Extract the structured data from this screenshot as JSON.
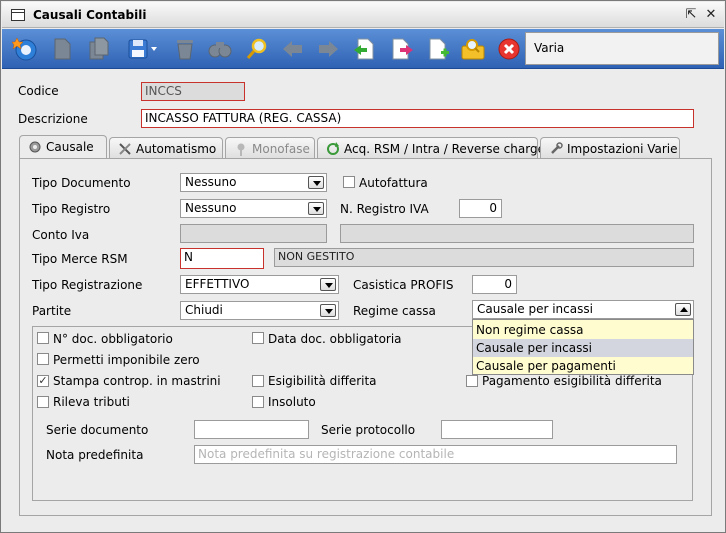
{
  "window": {
    "title": "Causali Contabili",
    "controls": [
      "restore",
      "close"
    ]
  },
  "toolbar": {
    "icons": [
      "home-icon",
      "document-icon",
      "copy-icon",
      "save-icon",
      "trash-icon",
      "binoculars-icon",
      "magnifier-icon",
      "back-arrow-icon",
      "forward-arrow-icon",
      "import-icon",
      "export-icon",
      "new-document-icon",
      "search-folder-icon",
      "cancel-icon"
    ],
    "varia_label": "Varia"
  },
  "header": {
    "codice_label": "Codice",
    "codice_value": "INCCS",
    "descrizione_label": "Descrizione",
    "descrizione_value": "INCASSO FATTURA (REG. CASSA)"
  },
  "tabs": [
    {
      "label": "Causale",
      "icon": "gear-icon"
    },
    {
      "label": "Automatismo",
      "icon": "tools-icon"
    },
    {
      "label": "Monofase",
      "icon": "pin-icon"
    },
    {
      "label": "Acq. RSM / Intra / Reverse charge",
      "icon": "refresh-icon"
    },
    {
      "label": "Impostazioni Varie",
      "icon": "wrench-icon"
    }
  ],
  "form": {
    "tipo_documento": {
      "label": "Tipo Documento",
      "value": "Nessuno"
    },
    "autofattura": {
      "label": "Autofattura"
    },
    "tipo_registro": {
      "label": "Tipo Registro",
      "value": "Nessuno"
    },
    "n_registro_iva": {
      "label": "N. Registro IVA",
      "value": "0"
    },
    "conto_iva": {
      "label": "Conto Iva"
    },
    "tipo_merce_rsm": {
      "label": "Tipo Merce RSM",
      "value": "N",
      "description": "NON GESTITO"
    },
    "tipo_registrazione": {
      "label": "Tipo Registrazione",
      "value": "EFFETTIVO"
    },
    "casistica_profis": {
      "label": "Casistica PROFIS",
      "value": "0"
    },
    "partite": {
      "label": "Partite",
      "value": "Chiudi"
    },
    "regime_cassa": {
      "label": "Regime cassa",
      "value": "Causale per incassi"
    }
  },
  "regime_dropdown": {
    "options": [
      "Non regime cassa",
      "Causale per incassi",
      "Causale per pagamenti"
    ],
    "selected_index": 1
  },
  "options": {
    "n_doc_obbligatorio": {
      "label": "N° doc. obbligatorio",
      "checked": false
    },
    "data_doc_obbligatoria": {
      "label": "Data doc. obbligatoria",
      "checked": false
    },
    "permetti_imponibile_zero": {
      "label": "Permetti imponibile zero",
      "checked": false
    },
    "stampa_controp": {
      "label": "Stampa controp. in mastrini",
      "checked": true
    },
    "esigibilita_differita": {
      "label": "Esigibilità differita",
      "checked": false
    },
    "pagamento_esigibilita": {
      "label": "Pagamento esigibilità differita",
      "checked": false
    },
    "rileva_tributi": {
      "label": "Rileva tributi",
      "checked": false
    },
    "insoluto": {
      "label": "Insoluto",
      "checked": false
    },
    "serie_documento": {
      "label": "Serie documento",
      "value": ""
    },
    "serie_protocollo": {
      "label": "Serie protocollo",
      "value": ""
    },
    "nota_predefinita": {
      "label": "Nota predefinita",
      "placeholder": "Nota predefinita su registrazione contabile"
    }
  }
}
